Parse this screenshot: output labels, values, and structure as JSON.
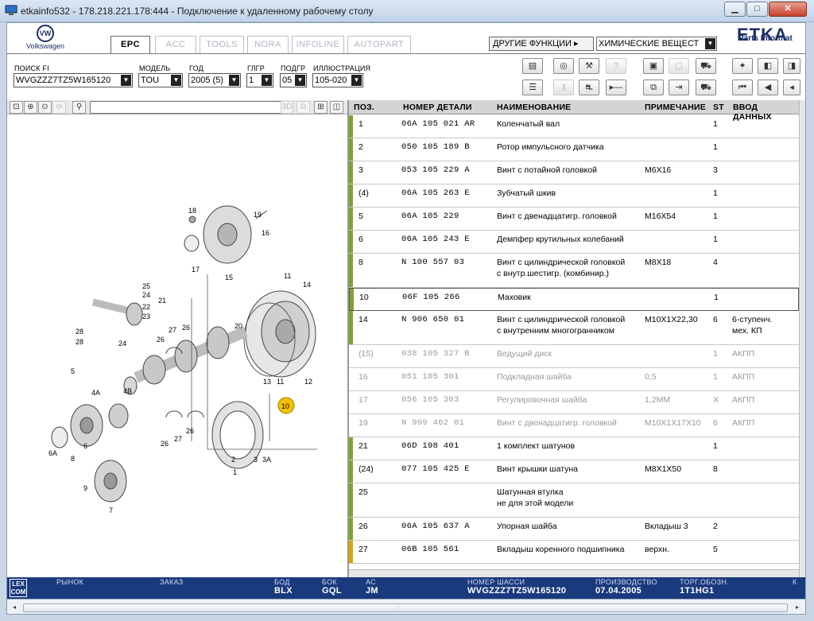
{
  "window": {
    "title": "etkainfo532 - 178.218.221.178:444 - Подключение к удаленному рабочему столу",
    "minimize": "▁",
    "maximize": "□",
    "close": "✕"
  },
  "brand": {
    "logo_text": "VW",
    "logo_label": "Volkswagen",
    "etka": "ETKA",
    "etka_sub": "Parts Informat"
  },
  "tabs": [
    "EPC",
    "ACC",
    "TOOLS",
    "NORA",
    "INFOLINE",
    "AUTOPART"
  ],
  "active_tab": "EPC",
  "functions": {
    "button": "ДРУГИЕ ФУНКЦИИ ▸",
    "select": "ХИМИЧЕСКИЕ ВЕЩЕСТ"
  },
  "filters": [
    {
      "label": "ПОИСК FI",
      "value": "WVGZZZ7TZ5W165120"
    },
    {
      "label": "МОДЕЛЬ",
      "value": "TOU"
    },
    {
      "label": "ГОД",
      "value": "2005 (5)"
    },
    {
      "label": "ГЛГР",
      "value": "1"
    },
    {
      "label": "ПОДГР",
      "value": "05"
    },
    {
      "label": "ИЛЛЮСТРАЦИЯ",
      "value": "105-020"
    }
  ],
  "image_toolbar": {
    "view3d": "3D"
  },
  "illustration": {
    "callouts": [
      "19",
      "18",
      "16",
      "17",
      "15",
      "25",
      "24",
      "21",
      "22",
      "23",
      "28",
      "28",
      "24",
      "26",
      "27",
      "26",
      "11",
      "14",
      "20",
      "13",
      "11",
      "12",
      "10",
      "5",
      "4A",
      "4B",
      "6",
      "6A",
      "8",
      "9",
      "7",
      "2",
      "27",
      "26",
      "26",
      "3",
      "3A",
      "1"
    ],
    "highlight": "10"
  },
  "grid": {
    "headers": [
      "ПОЗ.",
      "НОМЕР ДЕТАЛИ",
      "НАИМЕНОВАНИЕ",
      "ПРИМЕЧАНИЕ",
      "ST",
      "ВВОД ДАННЫХ"
    ],
    "rows": [
      {
        "pos": "1",
        "part": "06A 105 021 AR",
        "name": "Коленчатый вал",
        "name2": "",
        "note": "",
        "st": "1",
        "input": "",
        "input2": "",
        "bar": "#7fa330",
        "dim": false,
        "sel": false
      },
      {
        "pos": "2",
        "part": "050 105 189 B",
        "name": "Ротор импульсного датчика",
        "name2": "",
        "note": "",
        "st": "1",
        "input": "",
        "input2": "",
        "bar": "#7fa330",
        "dim": false,
        "sel": false
      },
      {
        "pos": "3",
        "part": "053 105 229 A",
        "name": "Винт с потайной головкой",
        "name2": "",
        "note": "M6X16",
        "st": "3",
        "input": "",
        "input2": "",
        "bar": "#7fa330",
        "dim": false,
        "sel": false
      },
      {
        "pos": "(4)",
        "part": "06A 105 263 E",
        "name": "Зубчатый шкив",
        "name2": "",
        "note": "",
        "st": "1",
        "input": "",
        "input2": "",
        "bar": "#7fa330",
        "dim": false,
        "sel": false
      },
      {
        "pos": "5",
        "part": "06A 105 229",
        "name": "Винт с двенадцатигр. головкой",
        "name2": "",
        "note": "M16X54",
        "st": "1",
        "input": "",
        "input2": "",
        "bar": "#7fa330",
        "dim": false,
        "sel": false
      },
      {
        "pos": "6",
        "part": "06A 105 243 E",
        "name": "Демпфер крутильных колебаний",
        "name2": "",
        "note": "",
        "st": "1",
        "input": "",
        "input2": "",
        "bar": "#7fa330",
        "dim": false,
        "sel": false
      },
      {
        "pos": "8",
        "part": "N  100 557 03",
        "name": "Винт с цилиндрической головкой",
        "name2": "с внутр.шестигр. (комбинир.)",
        "note": "M8X18",
        "st": "4",
        "input": "",
        "input2": "",
        "bar": "#7fa330",
        "dim": false,
        "sel": false
      },
      {
        "pos": "10",
        "part": "06F 105 266",
        "name": "Маховик",
        "name2": "",
        "note": "",
        "st": "1",
        "input": "",
        "input2": "",
        "bar": "#7fa330",
        "dim": false,
        "sel": true
      },
      {
        "pos": "14",
        "part": "N  906 650 01",
        "name": "Винт с цилиндрической головкой",
        "name2": "с внутренним многогранником",
        "note": "M10X1X22,30",
        "st": "6",
        "input": "6-ступенч.",
        "input2": "мех. КП",
        "bar": "#7fa330",
        "dim": false,
        "sel": false
      },
      {
        "pos": "(15)",
        "part": "038 105 327 B",
        "name": "Ведущий диск",
        "name2": "",
        "note": "",
        "st": "1",
        "input": "АКПП",
        "input2": "",
        "bar": "",
        "dim": true,
        "sel": false
      },
      {
        "pos": "16",
        "part": "051 105 301",
        "name": "Подкладная шайба",
        "name2": "",
        "note": "0,5",
        "st": "1",
        "input": "АКПП",
        "input2": "",
        "bar": "",
        "dim": true,
        "sel": false
      },
      {
        "pos": "17",
        "part": "056 105 303",
        "name": "Регулировочная шайба",
        "name2": "",
        "note": "1,2MM",
        "st": "X",
        "input": "АКПП",
        "input2": "",
        "bar": "",
        "dim": true,
        "sel": false
      },
      {
        "pos": "19",
        "part": "N  909 462 01",
        "name": "Винт с двенадцатигр. головкой",
        "name2": "",
        "note": "M10X1X17X10",
        "st": "6",
        "input": "АКПП",
        "input2": "",
        "bar": "",
        "dim": true,
        "sel": false
      },
      {
        "pos": "21",
        "part": "06D 198 401",
        "name": "1 комплект шатунов",
        "name2": "",
        "note": "",
        "st": "1",
        "input": "",
        "input2": "",
        "bar": "#7fa330",
        "dim": false,
        "sel": false
      },
      {
        "pos": "(24)",
        "part": "077 105 425 E",
        "name": "Винт крышки шатуна",
        "name2": "",
        "note": "M8X1X50",
        "st": "8",
        "input": "",
        "input2": "",
        "bar": "#7fa330",
        "dim": false,
        "sel": false
      },
      {
        "pos": "25",
        "part": "",
        "name": "Шатунная втулка",
        "name2": "не для этой модели",
        "note": "",
        "st": "",
        "input": "",
        "input2": "",
        "bar": "#7fa330",
        "dim": false,
        "sel": false
      },
      {
        "pos": "26",
        "part": "06A 105 637 A",
        "name": "Упорная шайба",
        "name2": "",
        "note": "Вкладыш 3",
        "st": "2",
        "input": "",
        "input2": "",
        "bar": "#7fa330",
        "dim": false,
        "sel": false
      },
      {
        "pos": "27",
        "part": "06B 105 561",
        "name": "Вкладыш коренного подшипника",
        "name2": "",
        "note": "верхн.",
        "st": "5",
        "input": "",
        "input2": "",
        "bar": "#e0a400",
        "dim": false,
        "sel": false
      }
    ]
  },
  "footer": {
    "lexcom": "LEX COM",
    "fields": [
      {
        "label": "РЫНОК",
        "value": ""
      },
      {
        "label": "ЗАКАЗ",
        "value": ""
      },
      {
        "label": "БОД",
        "value": "BLX"
      },
      {
        "label": "БОК",
        "value": "GQL"
      },
      {
        "label": "АС",
        "value": "JM"
      },
      {
        "label": "НОМЕР ШАССИ",
        "value": "WVGZZZ7TZ5W165120"
      },
      {
        "label": "ПРОИЗВОДСТВО",
        "value": "07.04.2005"
      },
      {
        "label": "ТОРГ.ОБОЗН.",
        "value": "1T1HG1"
      },
      {
        "label": "К",
        "value": ""
      }
    ]
  },
  "scroll": {
    "left": "◂",
    "right": "▸",
    "grip": "⦙"
  }
}
